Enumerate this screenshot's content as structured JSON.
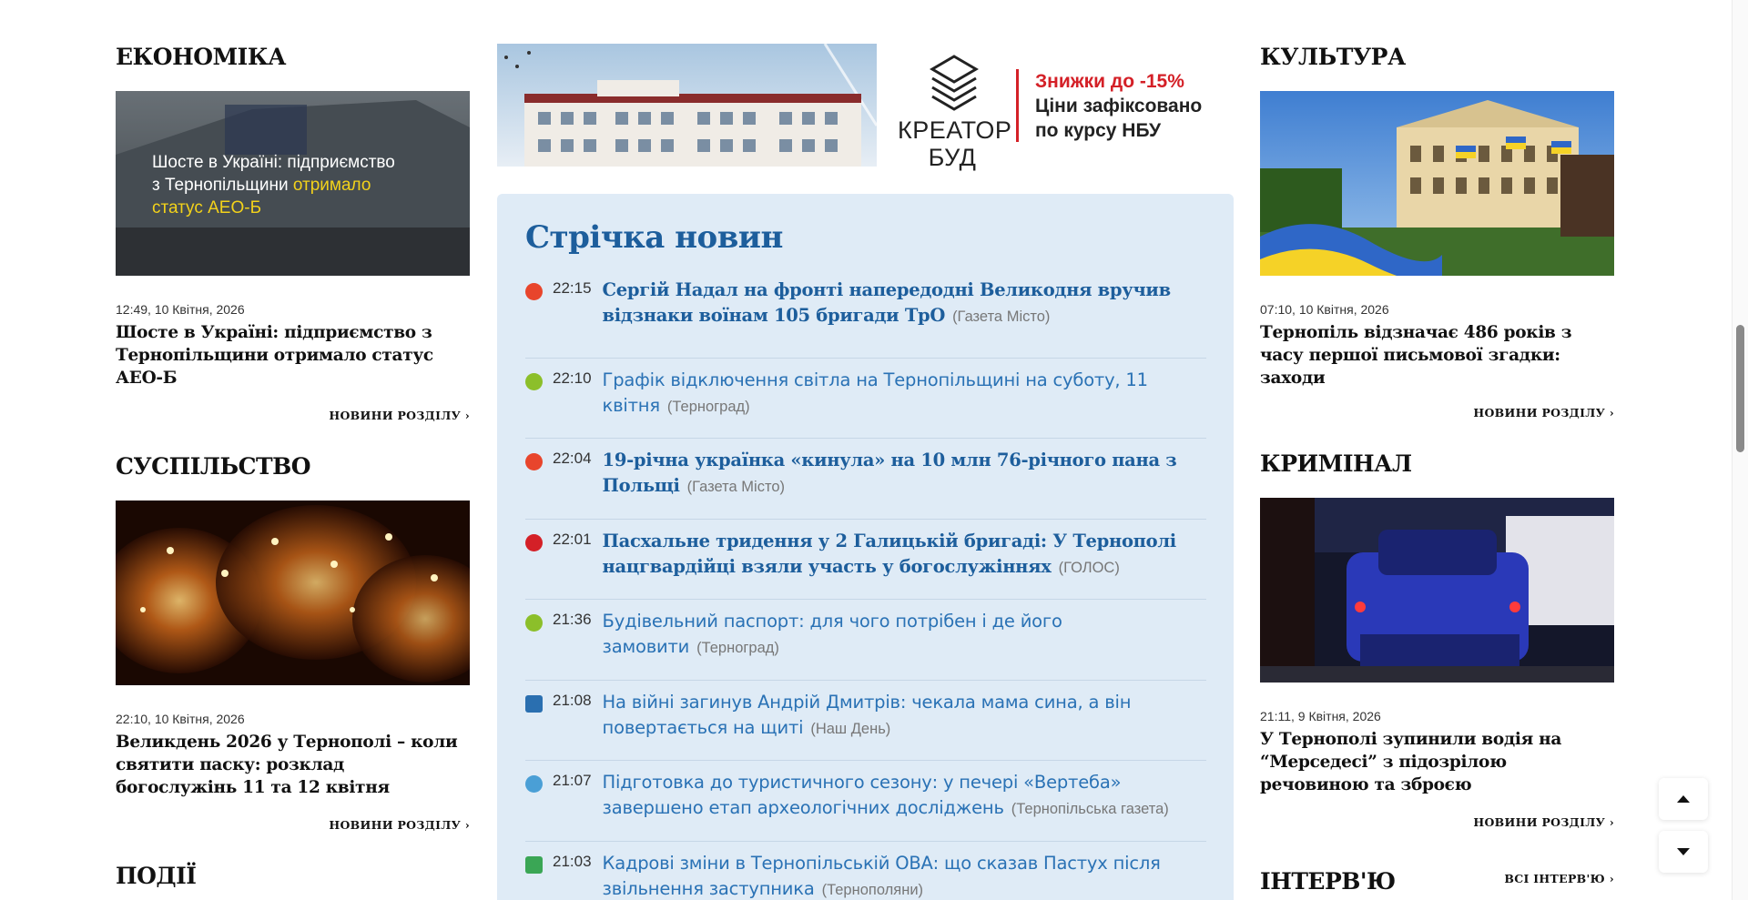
{
  "left": {
    "sections": [
      {
        "title": "ЕКОНОМІКА",
        "image_caption": [
          "Шосте в Україні: підприємство",
          "з Тернопільщини ",
          "отримало",
          "статус АЕО-Б"
        ],
        "date": "12:49, 10 Квітня, 2026",
        "headline": "Шосте в Україні: підприємство з Тернопільщини отримало статус АЕО-Б",
        "more": "НОВИНИ РОЗДІЛУ ›"
      },
      {
        "title": "СУСПІЛЬСТВО",
        "date": "22:10, 10 Квітня, 2026",
        "headline": "Великдень 2026 у Тернополі – коли святити паску: розклад богослужінь 11 та 12 квітня",
        "more": "НОВИНИ РОЗДІЛУ ›"
      },
      {
        "title": "ПОДІЇ"
      }
    ]
  },
  "ad": {
    "logo_line1": "КРЕАТОР",
    "logo_line2": "БУД",
    "promo": "Знижки до -15%",
    "line2": "Ціни зафіксовано",
    "line3": "по курсу НБУ"
  },
  "feed": {
    "title": "Стрічка новин",
    "items": [
      {
        "time": "22:15",
        "text": "Сергій Надал на фронті напередодні Великодня вручив відзнаки воїнам 105 бригади ТрО",
        "source": "(Газета Місто)",
        "bold": true,
        "icon": "gazeta-misto-icon",
        "icon_color": "#e8452c"
      },
      {
        "time": "22:10",
        "text": "Графік відключення світла на Тернопільщині на суботу, 11 квітня",
        "source": "(Терноград)",
        "bold": false,
        "icon": "ternohrad-icon",
        "icon_color": "#8cbf2a"
      },
      {
        "time": "22:04",
        "text": "19-річна українка «кинула» на 10 млн 76-річного пана з Польщі",
        "source": "(Газета Місто)",
        "bold": true,
        "icon": "gazeta-misto-icon",
        "icon_color": "#e8452c"
      },
      {
        "time": "22:01",
        "text": "Пасхальне тридення у 2 Галицькій бригаді: У Тернополі нацгвардійці взяли участь у богослужіннях",
        "source": "(ГОЛОС)",
        "bold": true,
        "icon": "holos-icon",
        "icon_color": "#d42027"
      },
      {
        "time": "21:36",
        "text": "Будівельний паспорт: для чого потрібен і де його замовити",
        "source": "(Терноград)",
        "bold": false,
        "icon": "ternohrad-icon",
        "icon_color": "#8cbf2a"
      },
      {
        "time": "21:08",
        "text": "На війні загинув Андрій Дмитрів: чекала мама сина, а він повертається на щиті",
        "source": "(Наш День)",
        "bold": false,
        "icon": "nash-den-icon",
        "icon_color": "#2a6fb0"
      },
      {
        "time": "21:07",
        "text": "Підготовка до туристичного сезону: у печері «Вертеба» завершено етап археологічних досліджень",
        "source": "(Тернопільська газета)",
        "bold": false,
        "icon": "ternopilska-gazeta-icon",
        "icon_color": "#4a9fd6"
      },
      {
        "time": "21:03",
        "text": "Кадрові зміни в Тернопільській ОВА: що сказав Пастух після звільнення заступника",
        "source": "(Тернополяни)",
        "bold": false,
        "icon": "ternopoliany-icon",
        "icon_color": "#3aa655"
      }
    ]
  },
  "right": {
    "sections": [
      {
        "title": "КУЛЬТУРА",
        "date": "07:10, 10 Квітня, 2026",
        "headline": "Тернопіль відзначає 486 років з часу першої письмової згадки: заходи",
        "more": "НОВИНИ РОЗДІЛУ ›"
      },
      {
        "title": "КРИМІНАЛ",
        "date": "21:11, 9 Квітня, 2026",
        "headline": "У Тернополі зупинили водія на “Мерседесі” з підозрілою речовиною та зброєю",
        "more": "НОВИНИ РОЗДІЛУ ›"
      },
      {
        "title": "ІНТЕРВ'Ю",
        "more": "ВСІ ІНТЕРВ'Ю ›"
      }
    ]
  }
}
